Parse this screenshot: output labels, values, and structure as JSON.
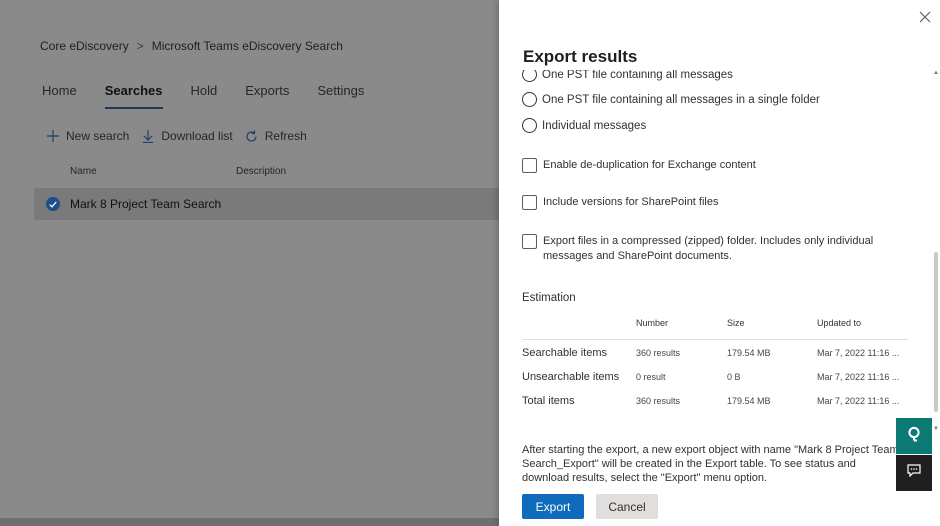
{
  "breadcrumb": {
    "root": "Core eDiscovery",
    "separator": ">",
    "current": "Microsoft Teams eDiscovery Search"
  },
  "tabs": [
    {
      "label": "Home"
    },
    {
      "label": "Searches"
    },
    {
      "label": "Hold"
    },
    {
      "label": "Exports"
    },
    {
      "label": "Settings"
    }
  ],
  "toolbar": {
    "new_search": "New search",
    "download_list": "Download list",
    "refresh": "Refresh"
  },
  "list": {
    "col_name": "Name",
    "col_description": "Description",
    "rows": [
      {
        "name": "Mark 8 Project Team Search",
        "selected": true
      }
    ]
  },
  "panel": {
    "title": "Export results",
    "radio_options": [
      {
        "label": "One PST file containing all messages"
      },
      {
        "label": "One PST file containing all messages in a single folder"
      },
      {
        "label": "Individual messages"
      }
    ],
    "checkboxes": [
      {
        "label": "Enable de-duplication for Exchange content",
        "checked": false
      },
      {
        "label": "Include versions for SharePoint files",
        "checked": false
      },
      {
        "label": "Export files in a compressed (zipped) folder. Includes only individual messages and SharePoint documents.",
        "checked": false
      }
    ],
    "estimation": {
      "heading": "Estimation",
      "columns": [
        "",
        "Number",
        "Size",
        "Updated to"
      ],
      "rows": [
        {
          "label": "Searchable items",
          "number": "360 results",
          "size": "179.54 MB",
          "updated": "Mar 7, 2022 11:16 ..."
        },
        {
          "label": "Unsearchable items",
          "number": "0 result",
          "size": "0 B",
          "updated": "Mar 7, 2022 11:16 ..."
        },
        {
          "label": "Total items",
          "number": "360 results",
          "size": "179.54 MB",
          "updated": "Mar 7, 2022 11:16 ..."
        }
      ]
    },
    "footer_text": "After starting the export, a new export object with name \"Mark 8 Project Team Search_Export\" will be created in the Export table. To see status and download results, select the \"Export\" menu option.",
    "export_label": "Export",
    "cancel_label": "Cancel"
  },
  "colors": {
    "primary": "#0f6cbd",
    "help_button": "#0b7a75",
    "feedback_button": "#1f1f1f"
  },
  "icons": {
    "close": "close-icon",
    "help": "help-icon",
    "feedback": "feedback-icon"
  }
}
